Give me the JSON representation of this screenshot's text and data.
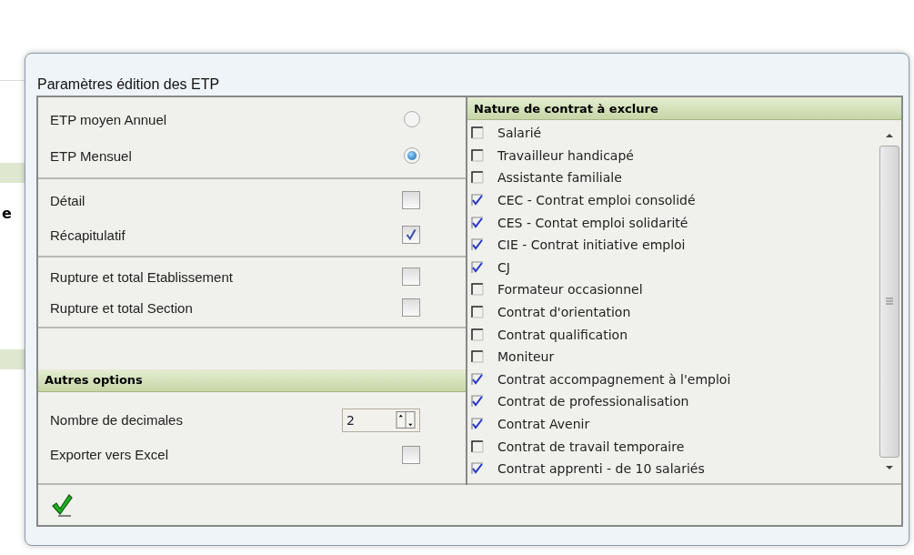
{
  "background": {
    "fragment": "e"
  },
  "dialog": {
    "title": "Paramètres édition des ETP"
  },
  "period_options": [
    {
      "label": "ETP moyen Annuel",
      "selected": false
    },
    {
      "label": "ETP Mensuel",
      "selected": true
    }
  ],
  "detail_options": [
    {
      "label": "Détail",
      "checked": false
    },
    {
      "label": "Récapitulatif",
      "checked": true
    }
  ],
  "break_options": [
    {
      "label": "Rupture et total Etablissement",
      "checked": false
    },
    {
      "label": "Rupture et total Section",
      "checked": false
    }
  ],
  "other_options": {
    "title": "Autres options",
    "decimals": {
      "label": "Nombre de decimales",
      "value": "2"
    },
    "export": {
      "label": "Exporter vers Excel",
      "checked": false
    }
  },
  "contracts": {
    "title": "Nature de contrat à exclure",
    "items": [
      {
        "label": "Salarié",
        "checked": false
      },
      {
        "label": "Travailleur handicapé",
        "checked": false
      },
      {
        "label": "Assistante familiale",
        "checked": false
      },
      {
        "label": "CEC - Contrat emploi consolidé",
        "checked": true
      },
      {
        "label": "CES - Contat emploi solidarité",
        "checked": true
      },
      {
        "label": "CIE - Contrat initiative emploi",
        "checked": true
      },
      {
        "label": "CJ",
        "checked": true
      },
      {
        "label": "Formateur occasionnel",
        "checked": false
      },
      {
        "label": "Contrat d'orientation",
        "checked": false
      },
      {
        "label": "Contrat qualification",
        "checked": false
      },
      {
        "label": "Moniteur",
        "checked": false
      },
      {
        "label": "Contrat accompagnement à l'emploi",
        "checked": true
      },
      {
        "label": "Contrat de professionalisation",
        "checked": true
      },
      {
        "label": "Contrat Avenir",
        "checked": true
      },
      {
        "label": "Contrat de travail temporaire",
        "checked": false
      },
      {
        "label": "Contrat apprenti - de 10 salariés",
        "checked": true
      }
    ]
  }
}
